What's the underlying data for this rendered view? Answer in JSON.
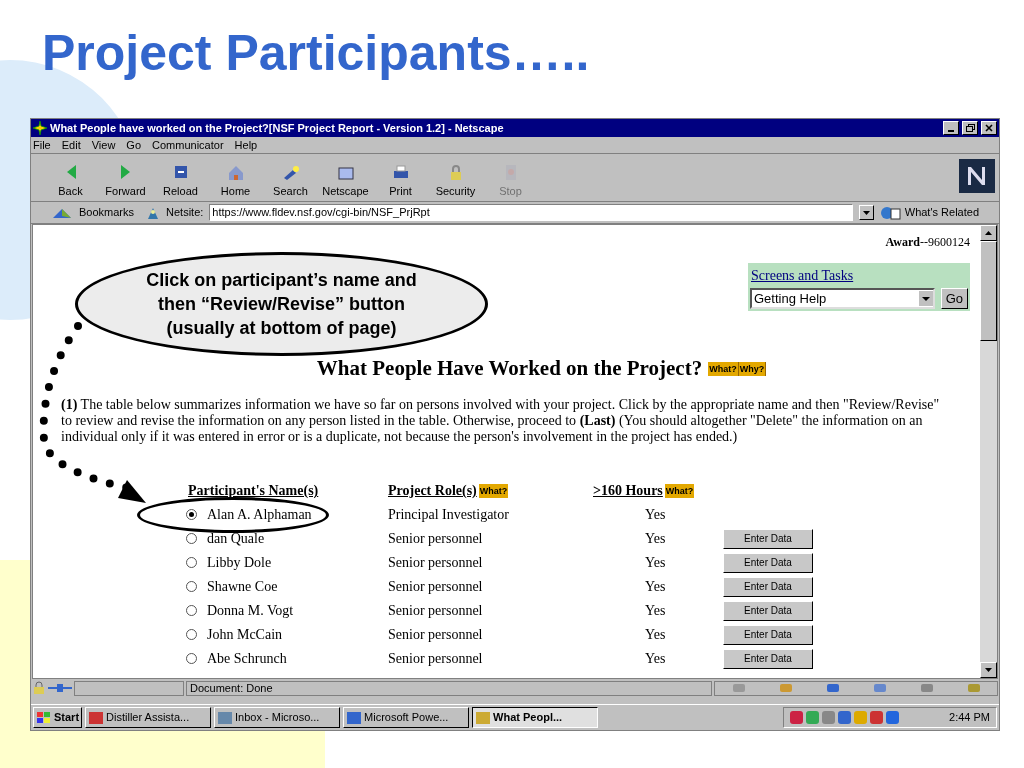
{
  "slide": {
    "title": "Project Participants….."
  },
  "browser": {
    "title": "What People have worked on the Project?[NSF Project Report - Version 1.2] - Netscape",
    "menu": [
      "File",
      "Edit",
      "View",
      "Go",
      "Communicator",
      "Help"
    ],
    "toolbar": [
      {
        "label": "Back",
        "disabled": false
      },
      {
        "label": "Forward",
        "disabled": false
      },
      {
        "label": "Reload",
        "disabled": false
      },
      {
        "label": "Home",
        "disabled": false
      },
      {
        "label": "Search",
        "disabled": false
      },
      {
        "label": "Netscape",
        "disabled": false
      },
      {
        "label": "Print",
        "disabled": false
      },
      {
        "label": "Security",
        "disabled": false
      },
      {
        "label": "Stop",
        "disabled": true
      }
    ],
    "location": {
      "bookmarks": "Bookmarks",
      "netsite_label": "Netsite:",
      "url": "https://www.fldev.nsf.gov/cgi-bin/NSF_PrjRpt",
      "related": "What's Related"
    },
    "page": {
      "award_label": "Award",
      "award_number": "--9600124",
      "screens": {
        "link": "Screens and Tasks",
        "select": "Getting Help",
        "go": "Go"
      },
      "heading": "What People Have Worked on the Project?",
      "heading_help": [
        "What?",
        "Why?"
      ],
      "paragraph": "**(1)** The table below summarizes information we have so far on persons involved with your project. Click by the appropriate name and then \"Review/Revise\" to review and revise the information on any person listed in the table. Otherwise, proceed to **(Last)** (You should altogether \"Delete\" the information on an individual only if it was entered in error or is a duplicate, not because the person's involvement in the project has ended.)",
      "columns": [
        {
          "label": "Participant's Name(s)"
        },
        {
          "label": "Project Role(s)",
          "help": "What?"
        },
        {
          "label": ">160 Hours",
          "help": "What?"
        }
      ],
      "rows": [
        {
          "name": "Alan A. Alphaman",
          "role": "Principal Investigator",
          "hours": "Yes",
          "selected": true,
          "action": null
        },
        {
          "name": "dan Quale",
          "role": "Senior personnel",
          "hours": "Yes",
          "selected": false,
          "action": "Enter Data"
        },
        {
          "name": "Libby Dole",
          "role": "Senior personnel",
          "hours": "Yes",
          "selected": false,
          "action": "Enter Data"
        },
        {
          "name": "Shawne Coe",
          "role": "Senior personnel",
          "hours": "Yes",
          "selected": false,
          "action": "Enter Data"
        },
        {
          "name": "Donna M. Vogt",
          "role": "Senior personnel",
          "hours": "Yes",
          "selected": false,
          "action": "Enter Data"
        },
        {
          "name": "John McCain",
          "role": "Senior personnel",
          "hours": "Yes",
          "selected": false,
          "action": "Enter Data"
        },
        {
          "name": "Abe Schrunch",
          "role": "Senior personnel",
          "hours": "Yes",
          "selected": false,
          "action": "Enter Data"
        }
      ]
    },
    "status": "Document: Done"
  },
  "taskbar": {
    "start": "Start",
    "items": [
      {
        "label": "Distiller Assista...",
        "selected": false
      },
      {
        "label": "Inbox - Microso...",
        "selected": false
      },
      {
        "label": "Microsoft Powe...",
        "selected": false
      },
      {
        "label": "What Peopl...",
        "selected": true
      }
    ],
    "clock": "2:44 PM"
  },
  "callout": {
    "lines": [
      "Click on participant’s name and",
      "then “Review/Revise” button",
      "(usually at bottom of page)"
    ]
  }
}
